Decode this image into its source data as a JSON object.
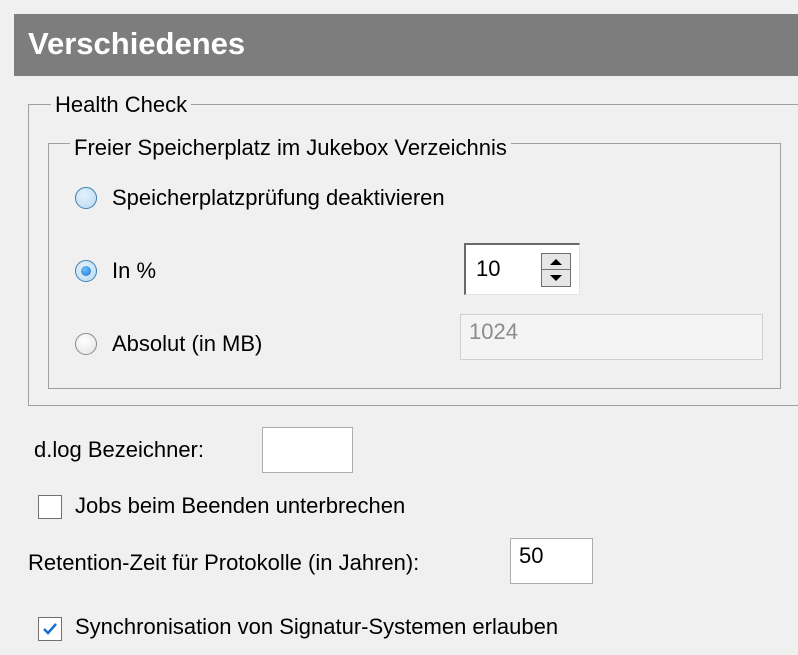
{
  "header": {
    "title": "Verschiedenes"
  },
  "health_check": {
    "legend": "Health Check",
    "disk_space": {
      "legend": "Freier Speicherplatz im Jukebox Verzeichnis",
      "options": [
        {
          "label": "Speicherplatzprüfung deaktivieren",
          "checked": false
        },
        {
          "label": "In %",
          "checked": true
        },
        {
          "label": "Absolut (in MB)",
          "checked": false
        }
      ],
      "percent_value": "10",
      "absolute_value": "1024"
    }
  },
  "dlog": {
    "label": "d.log Bezeichner:",
    "value": ""
  },
  "jobs_interrupt": {
    "label": "Jobs beim Beenden unterbrechen",
    "checked": false
  },
  "retention": {
    "label": "Retention-Zeit für Protokolle (in Jahren):",
    "value": "50"
  },
  "signature_sync": {
    "label": "Synchronisation von Signatur-Systemen erlauben",
    "checked": true
  }
}
